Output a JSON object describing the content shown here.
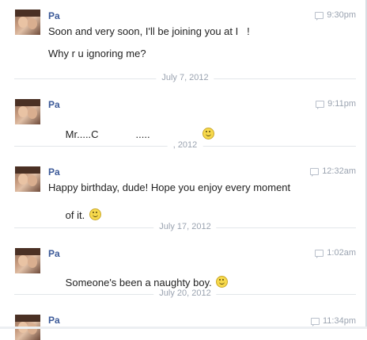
{
  "messages": [
    {
      "sender": "Pa",
      "time": "9:30pm",
      "lines": [
        "Soon and very soon, I'll be joining you at I   !",
        "Why r u ignoring me?"
      ]
    },
    {
      "sender": "Pa",
      "time": "9:11pm",
      "lines": [
        "Mr.....C             ....."
      ]
    },
    {
      "sender": "Pa",
      "time": "12:32am",
      "lines": [
        "Happy birthday, dude! Hope you enjoy every moment",
        "of it."
      ]
    },
    {
      "sender": "Pa",
      "time": "1:02am",
      "lines": [
        "Someone's been a naughty boy."
      ]
    },
    {
      "sender": "Pa",
      "time": "11:34pm",
      "lines": []
    }
  ],
  "dividers": [
    "July 7, 2012",
    ", 2012",
    "July 17, 2012",
    "July 20, 2012"
  ],
  "icons": {
    "message": "speech-bubble-icon",
    "emoticon": "smiley-icon"
  }
}
